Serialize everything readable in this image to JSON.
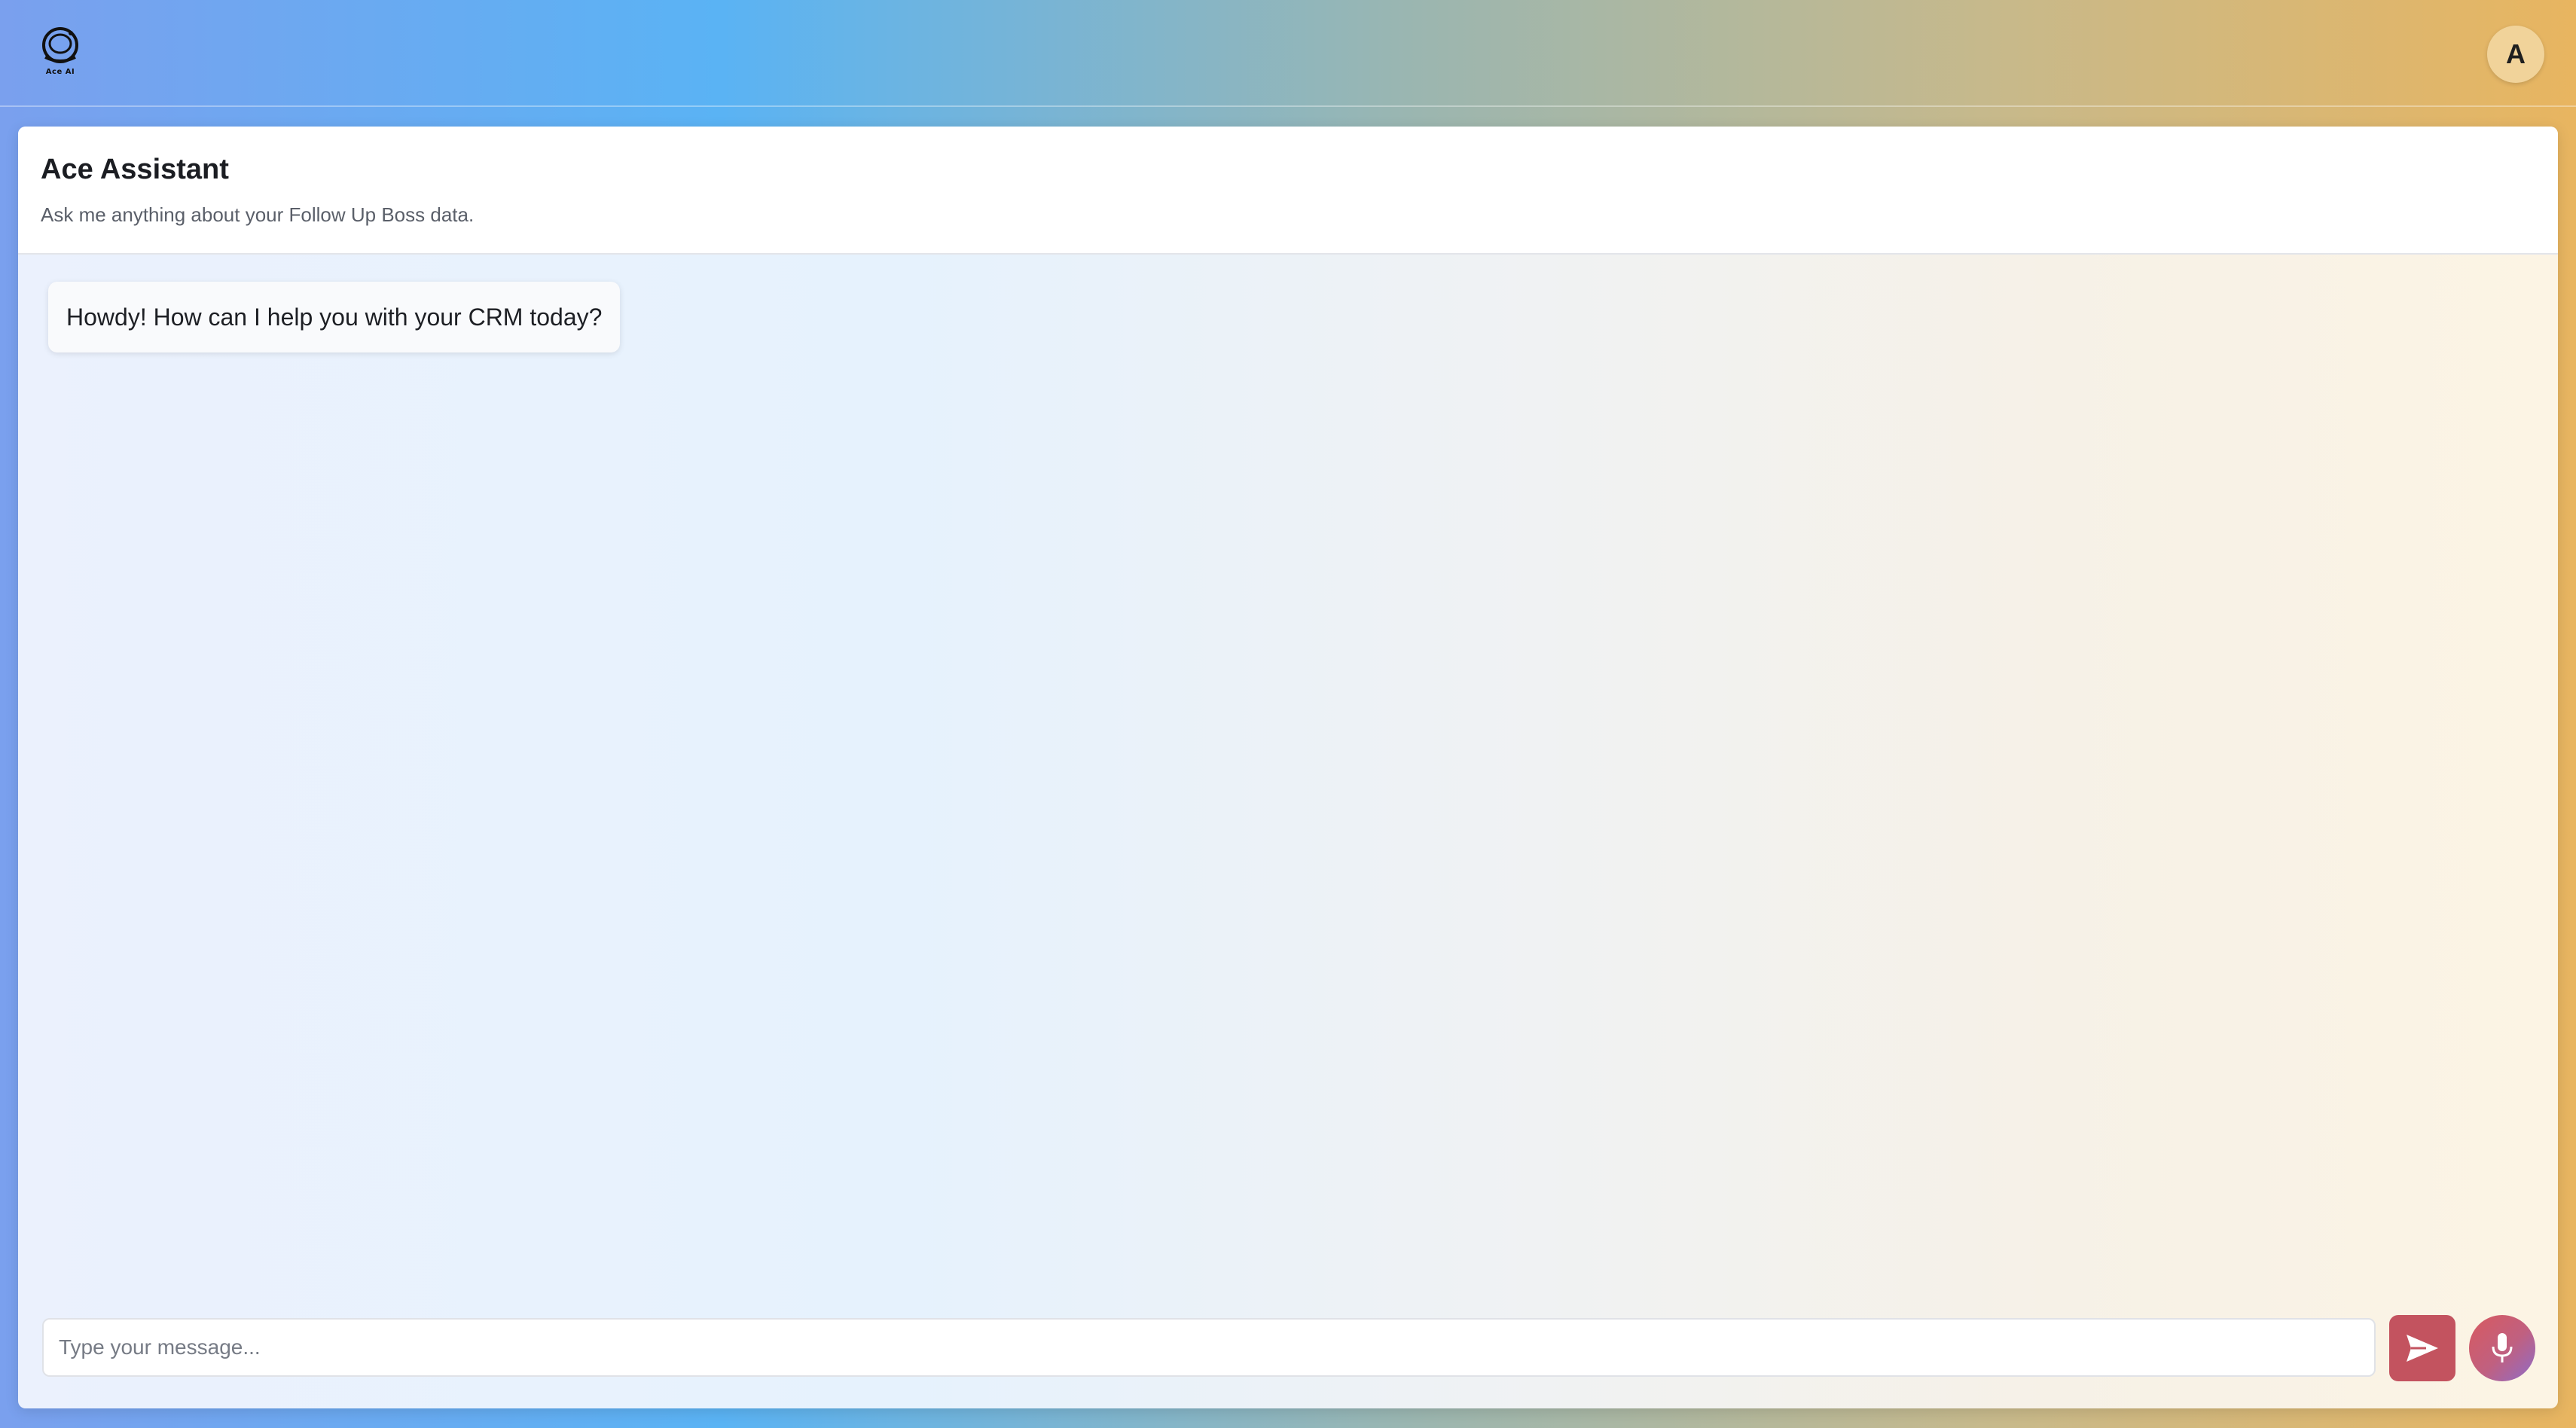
{
  "header": {
    "logo_text": "Ace AI",
    "avatar_initial": "A"
  },
  "assistant": {
    "title": "Ace Assistant",
    "subtitle": "Ask me anything about your Follow Up Boss data."
  },
  "messages": [
    {
      "role": "assistant",
      "text": "Howdy! How can I help you with your CRM today?"
    }
  ],
  "composer": {
    "placeholder": "Type your message..."
  },
  "icons": {
    "logo": "astronaut-helmet-icon",
    "send": "send-icon",
    "mic": "microphone-icon"
  },
  "colors": {
    "send_button": "#c3535f",
    "avatar_bg": "#f1d39a"
  }
}
